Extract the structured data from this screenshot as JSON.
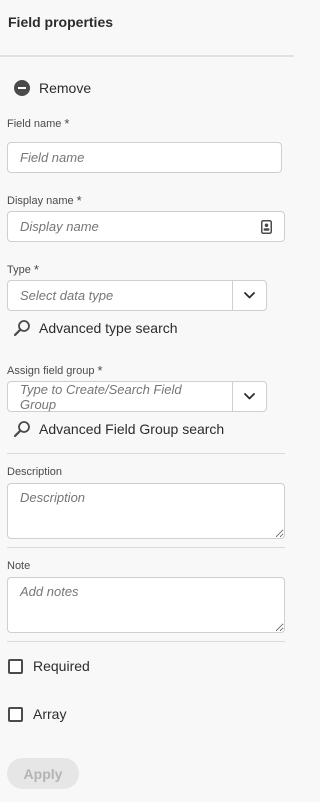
{
  "header": {
    "title": "Field properties"
  },
  "remove": {
    "label": "Remove",
    "icon": "remove-circle-icon"
  },
  "fields": {
    "field_name": {
      "label": "Field name",
      "required_mark": "*",
      "placeholder": "Field name",
      "value": ""
    },
    "display_name": {
      "label": "Display name",
      "required_mark": "*",
      "placeholder": "Display name",
      "value": ""
    },
    "type": {
      "label": "Type",
      "required_mark": "*",
      "placeholder": "Select data type",
      "value": ""
    },
    "field_group": {
      "label": "Assign field group",
      "required_mark": "*",
      "placeholder": "Type to Create/Search Field Group",
      "value": ""
    },
    "description": {
      "label": "Description",
      "placeholder": "Description",
      "value": ""
    },
    "note": {
      "label": "Note",
      "placeholder": "Add notes",
      "value": ""
    }
  },
  "advanced_type_search": {
    "label": "Advanced type search",
    "icon": "search-icon"
  },
  "advanced_field_group_search": {
    "label": "Advanced Field Group search",
    "icon": "search-icon"
  },
  "checkboxes": {
    "required": {
      "label": "Required",
      "checked": false
    },
    "array": {
      "label": "Array",
      "checked": false
    }
  },
  "actions": {
    "apply_label": "Apply",
    "apply_enabled": false
  },
  "colors": {
    "background": "#f8f8f8",
    "text": "#2c2c2c",
    "border": "#cfcfcf",
    "disabled_button": "#e6e6e6"
  }
}
